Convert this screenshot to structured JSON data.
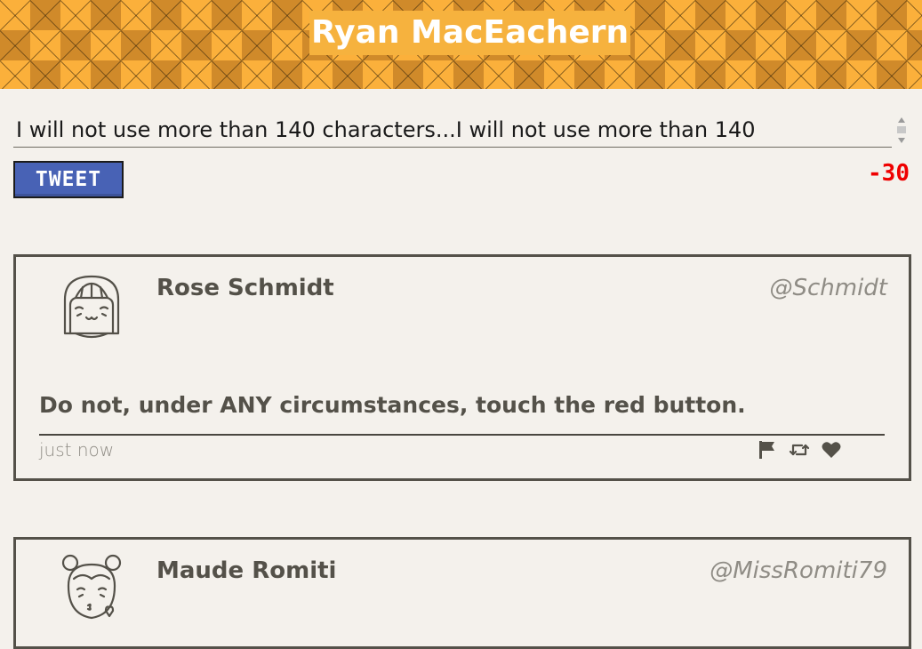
{
  "header": {
    "title": "Ryan MacEachern"
  },
  "compose": {
    "text": "I will not use more than 140 characters...I will not use more than 140",
    "button_label": "TWEET",
    "char_count": "-30"
  },
  "tweets": [
    {
      "name": "Rose Schmidt",
      "handle": "@Schmidt",
      "body": "Do not, under ANY circumstances, touch the red button.",
      "time": "just now",
      "avatar_icon": "girl-bangs-smiling-avatar",
      "actions": [
        "flag-icon",
        "retweet-icon",
        "heart-icon"
      ]
    },
    {
      "name": "Maude Romiti",
      "handle": "@MissRomiti79",
      "avatar_icon": "girl-buns-kiss-avatar"
    }
  ],
  "colors": {
    "header_orange": "#fbb03b",
    "button_blue": "#4862b5",
    "count_red": "#ef0000",
    "text_gray": "#545149",
    "background": "#f4f1ec"
  }
}
